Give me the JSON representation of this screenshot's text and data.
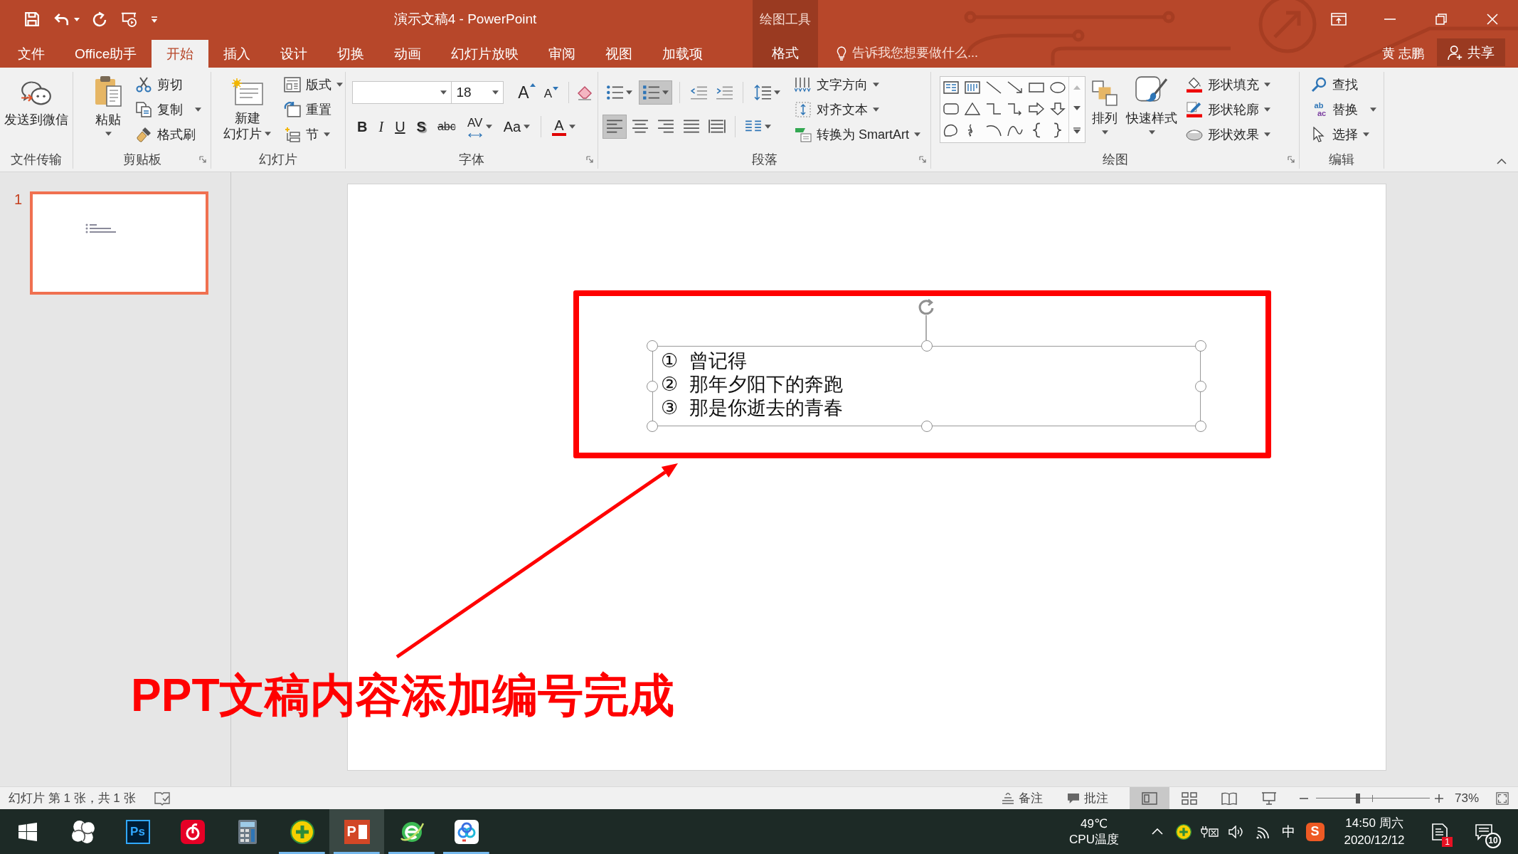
{
  "window": {
    "title": "演示文稿4 - PowerPoint",
    "contextual_group": "绘图工具"
  },
  "tabs": [
    {
      "label": "文件",
      "kind": "normal",
      "selected": false
    },
    {
      "label": "Office助手",
      "kind": "normal",
      "selected": false
    },
    {
      "label": "开始",
      "kind": "normal",
      "selected": true
    },
    {
      "label": "插入",
      "kind": "normal",
      "selected": false
    },
    {
      "label": "设计",
      "kind": "normal",
      "selected": false
    },
    {
      "label": "切换",
      "kind": "normal",
      "selected": false
    },
    {
      "label": "动画",
      "kind": "normal",
      "selected": false
    },
    {
      "label": "幻灯片放映",
      "kind": "normal",
      "selected": false
    },
    {
      "label": "审阅",
      "kind": "normal",
      "selected": false
    },
    {
      "label": "视图",
      "kind": "normal",
      "selected": false
    },
    {
      "label": "加载项",
      "kind": "normal",
      "selected": false
    },
    {
      "label": "格式",
      "kind": "contextual",
      "selected": false
    }
  ],
  "tell_me": {
    "placeholder": "告诉我您想要做什么..."
  },
  "account": {
    "user": "黄 志鹏",
    "share": "共享"
  },
  "ribbon": {
    "file_transfer": {
      "label": "文件传输",
      "send": "发送到微信"
    },
    "clipboard": {
      "label": "剪贴板",
      "paste": "粘贴",
      "cut": "剪切",
      "copy": "复制",
      "format_painter": "格式刷"
    },
    "slides": {
      "label": "幻灯片",
      "new_slide": [
        "新建",
        "幻灯片"
      ],
      "layout": "版式",
      "reset": "重置",
      "section": "节"
    },
    "font": {
      "label": "字体",
      "size": "18",
      "grow": "A",
      "shrink": "A",
      "styles": [
        {
          "kind": "bold",
          "label": "B"
        },
        {
          "kind": "italic",
          "label": "I"
        },
        {
          "kind": "underline",
          "label": "U"
        },
        {
          "kind": "shadow",
          "label": "S"
        },
        {
          "kind": "strikethrough",
          "label": "abc"
        },
        {
          "kind": "spacing",
          "label": "AV"
        },
        {
          "kind": "case",
          "label": "Aa"
        }
      ],
      "font_color": "A"
    },
    "paragraph": {
      "label": "段落",
      "list_buttons": [
        {
          "kind": "bullets",
          "pressed": false
        },
        {
          "kind": "numbering",
          "pressed": true
        }
      ],
      "align_buttons": [
        {
          "kind": "left",
          "pressed": true
        },
        {
          "kind": "center",
          "pressed": false
        },
        {
          "kind": "right",
          "pressed": false
        },
        {
          "kind": "justify",
          "pressed": false
        },
        {
          "kind": "distributed",
          "pressed": false
        }
      ],
      "text_direction": "文字方向",
      "align_text": "对齐文本",
      "smartart": "转换为 SmartArt"
    },
    "drawing": {
      "label": "绘图",
      "arrange": "排列",
      "quick_styles": "快速样式",
      "fill": "形状填充",
      "outline": "形状轮廓",
      "effects": "形状效果"
    },
    "editing": {
      "label": "编辑",
      "find": "查找",
      "replace": "替换",
      "replace_glyph": [
        "ab",
        "ac"
      ],
      "select": "选择"
    }
  },
  "thumbnails": [
    {
      "number": "1",
      "selected": true
    }
  ],
  "slide": {
    "list": [
      {
        "marker": "①",
        "text": "曾记得"
      },
      {
        "marker": "②",
        "text": "那年夕阳下的奔跑"
      },
      {
        "marker": "③",
        "text": "那是你逝去的青春"
      }
    ]
  },
  "annotation": {
    "caption": "PPT文稿内容添加编号完成"
  },
  "status_bar": {
    "slide_info": "幻灯片 第 1 张，共 1 张",
    "notes": "备注",
    "comments": "批注",
    "views": [
      {
        "kind": "normal",
        "selected": true
      },
      {
        "kind": "sorter",
        "selected": false
      },
      {
        "kind": "reading",
        "selected": false
      },
      {
        "kind": "slideshow",
        "selected": false
      }
    ],
    "zoom": {
      "level": 0.37,
      "reading": "73%"
    }
  },
  "taskbar": {
    "apps": [
      {
        "kind": "pinwheel",
        "running": false,
        "selected": false
      },
      {
        "kind": "photoshop",
        "label": "Ps",
        "running": false,
        "selected": false
      },
      {
        "kind": "music",
        "running": false,
        "selected": false
      },
      {
        "kind": "calculator",
        "running": false,
        "selected": false
      },
      {
        "kind": "plus",
        "running": true,
        "selected": false
      },
      {
        "kind": "powerpoint",
        "label": "P",
        "running": true,
        "selected": true
      },
      {
        "kind": "browser",
        "running": true,
        "selected": false
      },
      {
        "kind": "cloud",
        "running": true,
        "selected": false
      }
    ],
    "cpu": {
      "value": "49℃",
      "label": "CPU温度"
    },
    "ime": "中",
    "ime_logo": "S",
    "clock": {
      "time": "14:50 周六",
      "date": "2020/12/12"
    },
    "message_badge": "1",
    "notification_badge": "10"
  }
}
